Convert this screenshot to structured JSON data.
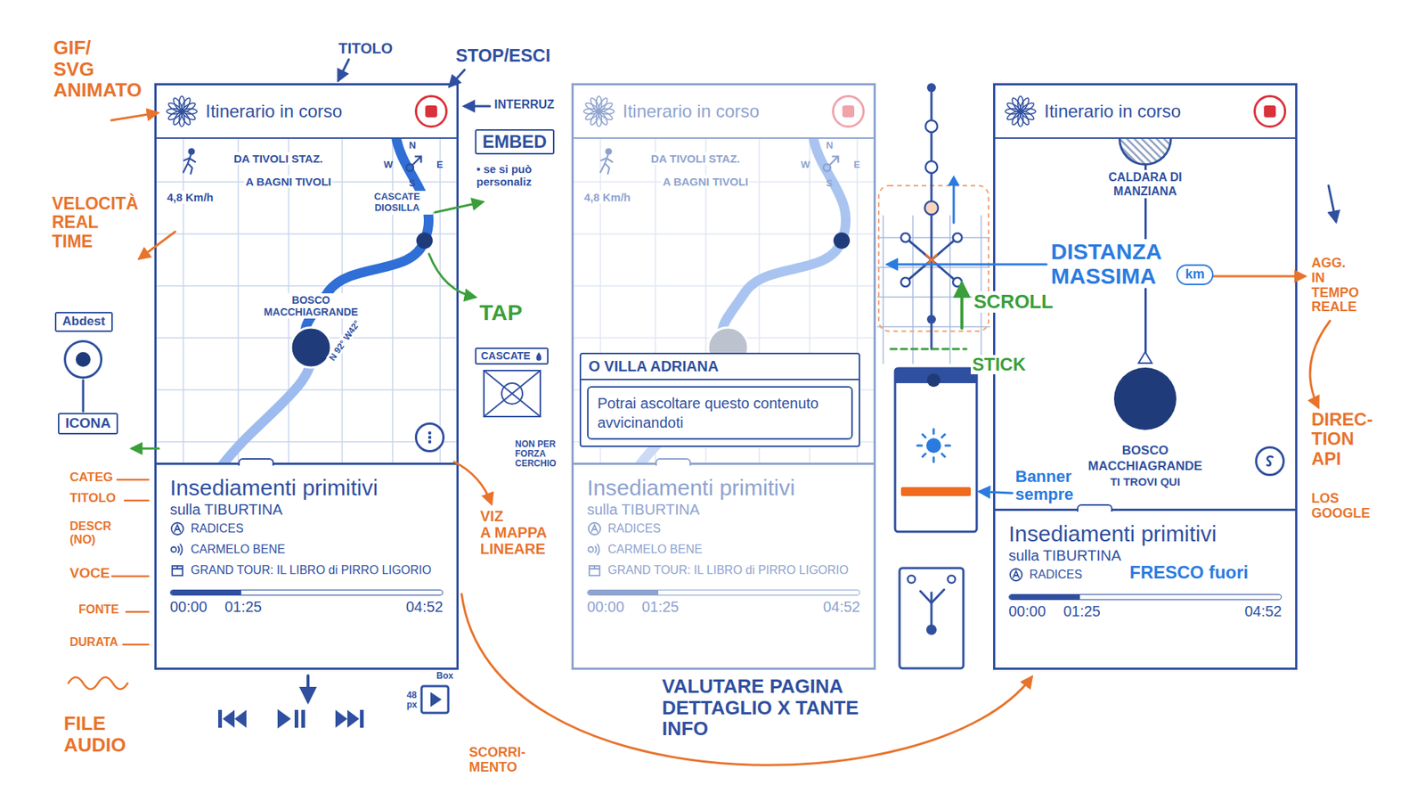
{
  "screens": [
    {
      "kind": "map",
      "faded": false,
      "title": "Itinerario in corso",
      "trip": {
        "from": "DA TIVOLI STAZ.",
        "to": "A BAGNI TIVOLI",
        "speed": "4,8 Km/h"
      },
      "compass": [
        "N",
        "E",
        "S",
        "W"
      ],
      "places": [
        {
          "name": "CASCATE DIOSILLA"
        },
        {
          "name": "BOSCO MACCHIAGRANDE"
        }
      ],
      "coords": "N 92° W42°",
      "card": {
        "title": "Insediamenti primitivi",
        "subtitle": "sulla TIBURTINA",
        "category": "RADICES",
        "voice": "CARMELO BENE",
        "source": "GRAND TOUR: IL LIBRO di PIRRO LIGORIO",
        "elapsed": "00:00",
        "position": "01:25",
        "total": "04:52",
        "level": 0.26
      }
    },
    {
      "kind": "map",
      "faded": true,
      "title": "Itinerario in corso",
      "trip": {
        "from": "DA TIVOLI STAZ.",
        "to": "A BAGNI TIVOLI",
        "speed": "4,8 Km/h"
      },
      "compass": [
        "N",
        "E",
        "S",
        "W"
      ],
      "places": [],
      "popup": {
        "title": "O VILLA ADRIANA",
        "text": "Potrai ascoltare questo contenuto avvicinandoti"
      },
      "card": {
        "title": "Insediamenti primitivi",
        "subtitle": "sulla TIBURTINA",
        "category": "RADICES",
        "voice": "CARMELO BENE",
        "source": "GRAND TOUR: IL LIBRO di PIRRO LIGORIO",
        "elapsed": "00:00",
        "position": "01:25",
        "total": "04:52",
        "level": 0.26
      }
    },
    {
      "kind": "linear",
      "faded": false,
      "title": "Itinerario in corso",
      "stops": [
        {
          "name": "CALDARA DI MANZIANA",
          "current": false
        },
        {
          "name": "BOSCO MACCHIAGRANDE",
          "current": true
        }
      ],
      "here": "TI TROVI QUI",
      "card": {
        "title": "Insediamenti primitivi",
        "subtitle": "sulla TIBURTINA",
        "category": "RADICES",
        "elapsed": "00:00",
        "position": "01:25",
        "total": "04:52",
        "level": 0.26
      }
    }
  ],
  "annotations": [
    {
      "text": "GIF/\nSVG\nANIMATO",
      "kind": "note",
      "color": "#e8732c"
    },
    {
      "text": "VELOCITÀ\nREAL\nTIME",
      "kind": "note",
      "color": "#e8732c"
    },
    {
      "text": "Abdest",
      "kind": "boxed",
      "color": "#2f4f9f"
    },
    {
      "text": "ICONA",
      "kind": "boxed",
      "color": "#2f4f9f"
    },
    {
      "text": "CATEG",
      "kind": "note",
      "color": "#e8732c"
    },
    {
      "text": "TITOLO",
      "kind": "note",
      "color": "#e8732c"
    },
    {
      "text": "DESCR\n(NO)",
      "kind": "note",
      "color": "#e8732c"
    },
    {
      "text": "VOCE",
      "kind": "note",
      "color": "#e8732c"
    },
    {
      "text": "FONTE",
      "kind": "note",
      "color": "#e8732c"
    },
    {
      "text": "DURATA",
      "kind": "note",
      "color": "#e8732c"
    },
    {
      "text": "FILE\nAUDIO",
      "kind": "note",
      "color": "#e8732c"
    },
    {
      "text": "TITOLO",
      "kind": "note",
      "color": "#2f4f9f"
    },
    {
      "text": "STOP/ESCI",
      "kind": "note",
      "color": "#2f4f9f"
    },
    {
      "text": "INTERRUZ",
      "kind": "note",
      "color": "#2f4f9f"
    },
    {
      "text": "EMBED",
      "kind": "boxed",
      "color": "#2f4f9f"
    },
    {
      "text": "• se si può\npersonaliz",
      "kind": "note",
      "color": "#2f4f9f"
    },
    {
      "text": "TAP",
      "kind": "note",
      "color": "#3a9f3a"
    },
    {
      "text": "CASCATE",
      "kind": "sketch",
      "color": "#2f4f9f"
    },
    {
      "text": "NON PER\nFORZA\nCERCHIO",
      "kind": "note",
      "color": "#2f4f9f"
    },
    {
      "text": "VIZ\nA MAPPA\nLINEARE",
      "kind": "note",
      "color": "#e8732c"
    },
    {
      "text": "48\npx",
      "kind": "note",
      "color": "#2f4f9f"
    },
    {
      "text": "Box",
      "kind": "note",
      "color": "#2f4f9f"
    },
    {
      "text": "SCORRI-\nMENTO",
      "kind": "note",
      "color": "#e8732c"
    },
    {
      "text": "VALUTARE PAGINA\nDETTAGLIO X TANTE\nINFO",
      "kind": "note",
      "color": "#2f4f9f"
    },
    {
      "text": "DISTANZA\nMASSIMA",
      "kind": "note",
      "color": "#2a7be0"
    },
    {
      "text": "km",
      "kind": "pill",
      "color": "#2a7be0"
    },
    {
      "text": "SCROLL",
      "kind": "note",
      "color": "#3a9f3a"
    },
    {
      "text": "STICK",
      "kind": "note",
      "color": "#3a9f3a"
    },
    {
      "text": "Banner\nsempre",
      "kind": "note",
      "color": "#2a7be0"
    },
    {
      "text": "FRESCO fuori",
      "kind": "note",
      "color": "#2a7be0"
    },
    {
      "text": "AGG.\nIN\nTEMPO\nREALE",
      "kind": "note",
      "color": "#e8732c"
    },
    {
      "text": "DIREC-\nTION\nAPI",
      "kind": "note",
      "color": "#e8732c"
    },
    {
      "text": "LOS\nGOOGLE",
      "kind": "note",
      "color": "#e8732c"
    }
  ]
}
